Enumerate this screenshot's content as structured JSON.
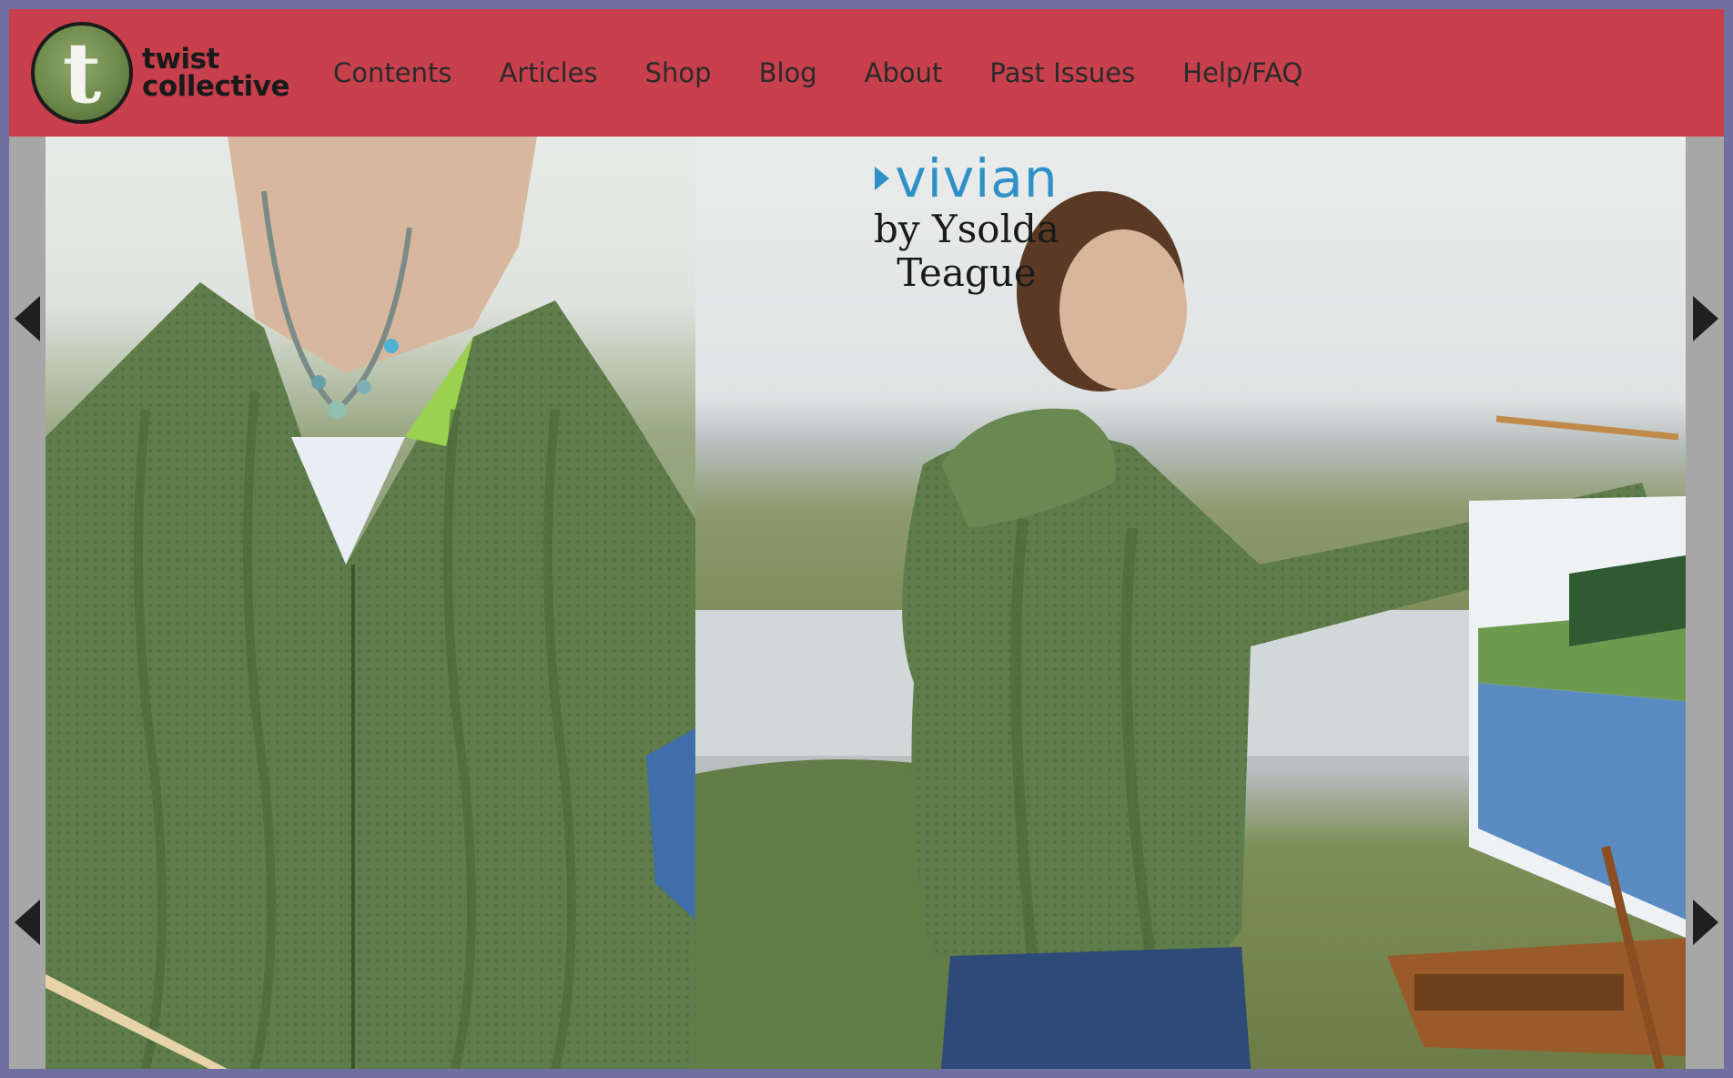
{
  "brand": {
    "badge_letter": "t",
    "line1": "twist",
    "line2": "collective",
    "header_color": "#c8404d"
  },
  "nav": {
    "items": [
      {
        "label": "Contents"
      },
      {
        "label": "Articles"
      },
      {
        "label": "Shop"
      },
      {
        "label": "Blog"
      },
      {
        "label": "About"
      },
      {
        "label": "Past Issues"
      },
      {
        "label": "Help/FAQ"
      }
    ]
  },
  "feature": {
    "title": "vivian",
    "byline": "by Ysolda Teague",
    "title_color": "#2f90c8"
  },
  "controls": {
    "prev_icon": "triangle-left-icon",
    "next_icon": "triangle-right-icon"
  }
}
